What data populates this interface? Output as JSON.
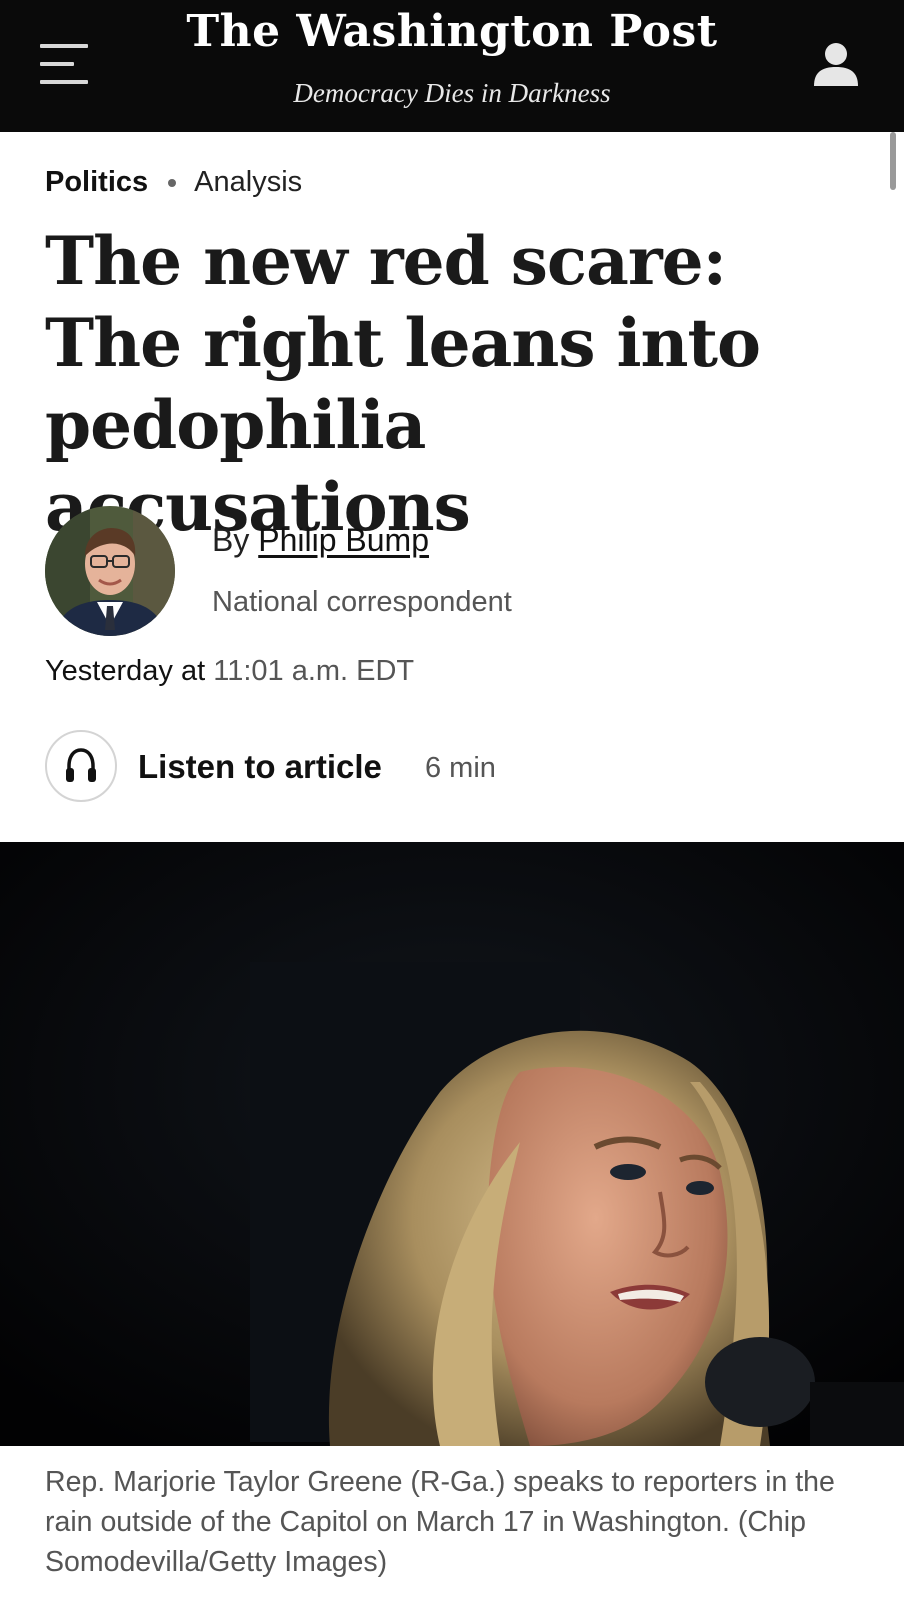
{
  "header": {
    "masthead": "The Washington Post",
    "tagline": "Democracy Dies in Darkness",
    "menu_icon": "hamburger-menu-icon",
    "account_icon": "user-account-icon"
  },
  "article": {
    "section": "Politics",
    "label": "Analysis",
    "headline": "The new red scare: The right leans into pedophilia accusations",
    "byline_prefix": "By",
    "author": "Philip Bump",
    "author_role": "National correspondent",
    "date_prefix": "Yesterday at",
    "time": "11:01 a.m. EDT"
  },
  "listen": {
    "label": "Listen to article",
    "duration": "6 min",
    "icon": "headphones-icon"
  },
  "photo": {
    "caption": "Rep. Marjorie Taylor Greene (R-Ga.) speaks to reporters in the rain outside of the Capitol on March 17 in Washington. (Chip Somodevilla/Getty Images)"
  },
  "colors": {
    "header_bg": "#0a0a0a",
    "text_primary": "#111111",
    "text_secondary": "#555555"
  }
}
